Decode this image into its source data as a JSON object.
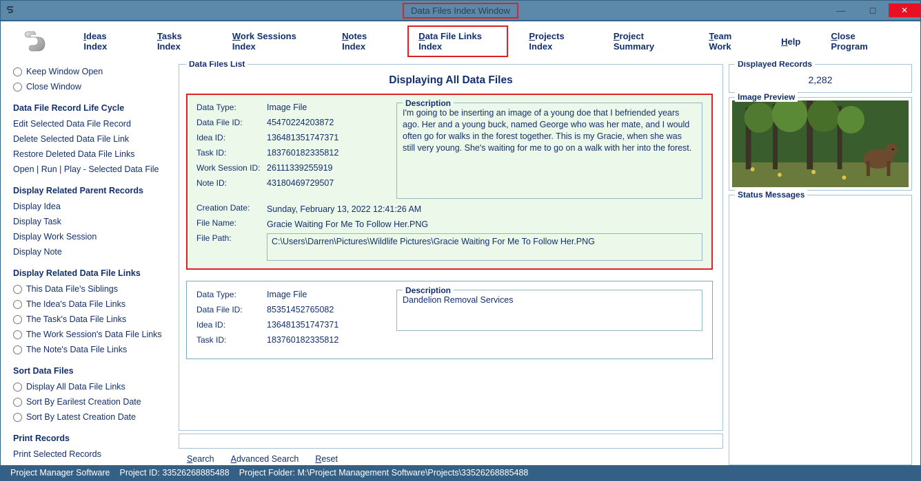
{
  "window": {
    "title": "Data Files Index Window"
  },
  "menubar": {
    "items": [
      {
        "label": "Ideas Index",
        "ul": 0
      },
      {
        "label": "Tasks Index",
        "ul": 0
      },
      {
        "label": "Work Sessions Index",
        "ul": 0
      },
      {
        "label": "Notes Index",
        "ul": 0
      },
      {
        "label": "Data File Links Index",
        "ul": 0,
        "highlighted": true
      },
      {
        "label": "Projects Index",
        "ul": 0
      },
      {
        "label": "Project Summary",
        "ul": 0
      },
      {
        "label": "Team Work",
        "ul": 0
      },
      {
        "label": "Help",
        "ul": 0
      },
      {
        "label": "Close Program",
        "ul": 0
      }
    ]
  },
  "sidebar": {
    "window_opts": [
      {
        "label": "Keep Window Open"
      },
      {
        "label": "Close Window"
      }
    ],
    "lifecycle_title": "Data File Record Life Cycle",
    "lifecycle": [
      "Edit Selected Data File Record",
      "Delete Selected Data File Link",
      "Restore Deleted Data File Links",
      "Open | Run | Play - Selected Data File"
    ],
    "parent_title": "Display Related Parent Records",
    "parent": [
      "Display Idea",
      "Display Task",
      "Display Work Session",
      "Display Note"
    ],
    "related_title": "Display Related Data File Links",
    "related": [
      "This Data File's Siblings",
      "The Idea's Data File Links",
      "The Task's Data File Links",
      "The Work Session's Data File Links",
      "The Note's Data File Links"
    ],
    "sort_title": "Sort Data Files",
    "sort": [
      "Display All Data File Links",
      "Sort By Earilest Creation Date",
      "Sort By Latest Creation Date"
    ],
    "print_title": "Print Records",
    "print": [
      "Print Selected Records"
    ]
  },
  "list": {
    "legend": "Data Files List",
    "title": "Displaying All Data Files",
    "records": [
      {
        "selected": true,
        "data_type": "Image File",
        "data_file_id": "45470224203872",
        "idea_id": "136481351747371",
        "task_id": "183760182335812",
        "work_session_id": "26111339255919",
        "note_id": "43180469729507",
        "creation_date": "Sunday, February 13, 2022   12:41:26 AM",
        "file_name": "Gracie Waiting For Me To Follow Her.PNG",
        "file_path": "C:\\Users\\Darren\\Pictures\\Wildlife Pictures\\Gracie Waiting For Me To Follow Her.PNG",
        "description": "I'm going to be inserting an image of a young doe that I befriended years ago. Her and a young buck, named George who was her mate, and I would often go for walks in the forest together. This is my Gracie, when she was still very young. She's waiting for me to go on a walk with her into the forest."
      },
      {
        "selected": false,
        "data_type": "Image File",
        "data_file_id": "85351452765082",
        "idea_id": "136481351747371",
        "task_id": "183760182335812",
        "description": "Dandelion Removal Services"
      }
    ],
    "labels": {
      "data_type": "Data Type:",
      "data_file_id": "Data File ID:",
      "idea_id": "Idea ID:",
      "task_id": "Task ID:",
      "work_session_id": "Work Session ID:",
      "note_id": "Note ID:",
      "creation_date": "Creation Date:",
      "file_name": "File Name:",
      "file_path": "File Path:",
      "description": "Description"
    },
    "search": {
      "search": "Search",
      "advanced": "Advanced Search",
      "reset": "Reset"
    }
  },
  "right": {
    "displayed_legend": "Displayed Records",
    "displayed_count": "2,282",
    "image_legend": "Image Preview",
    "status_legend": "Status Messages"
  },
  "statusbar": {
    "app": "Project Manager Software",
    "project_id_label": "Project ID:",
    "project_id": "33526268885488",
    "folder_label": "Project Folder:",
    "folder": "M:\\Project Management Software\\Projects\\33526268885488"
  }
}
